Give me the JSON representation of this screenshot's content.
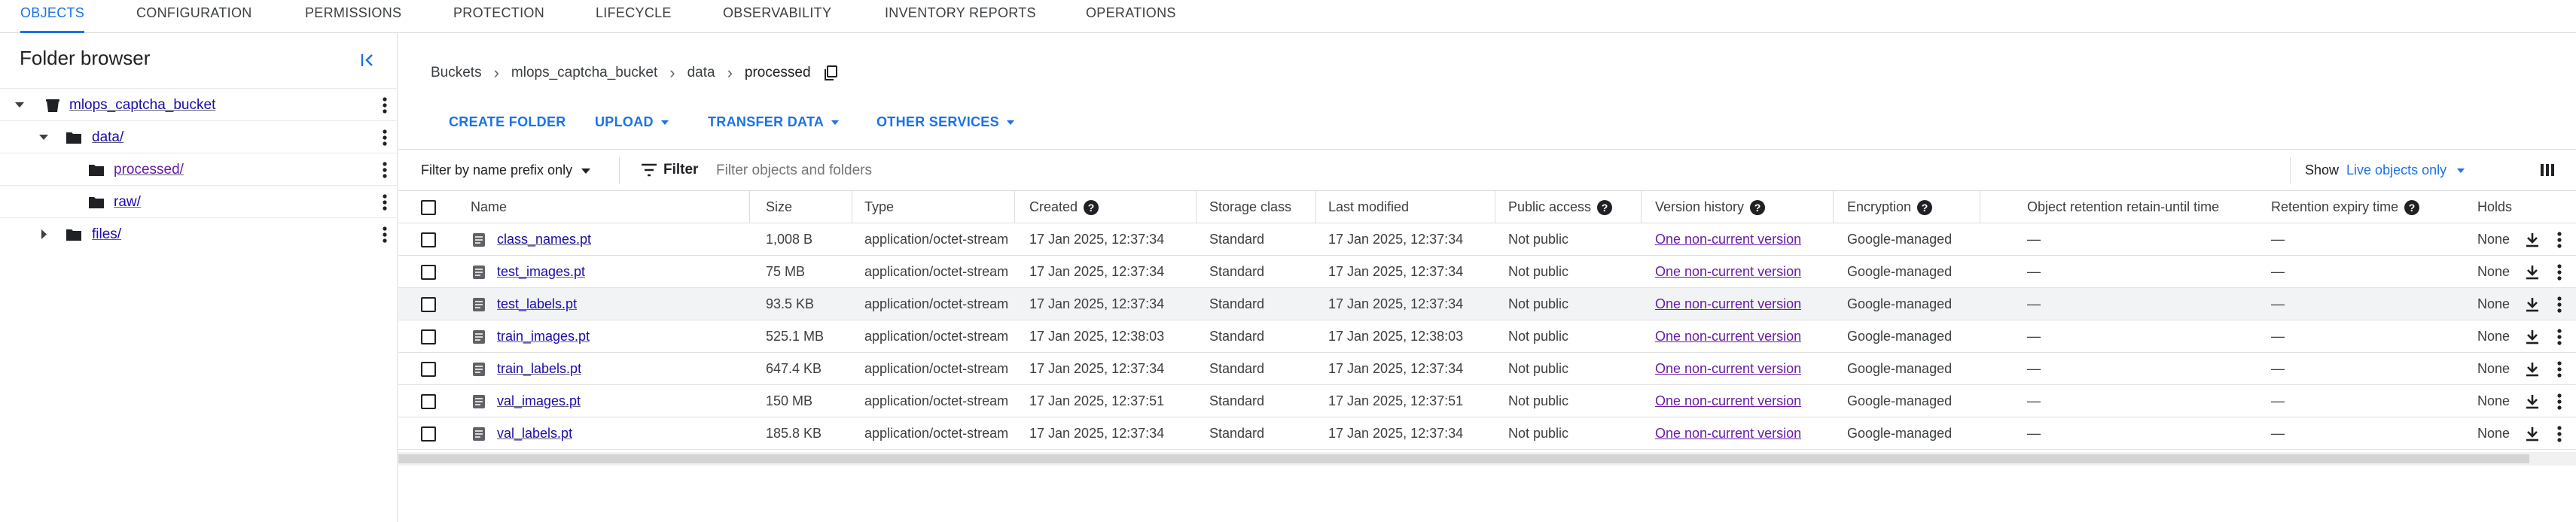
{
  "tabs": [
    {
      "label": "OBJECTS",
      "active": true
    },
    {
      "label": "CONFIGURATION"
    },
    {
      "label": "PERMISSIONS"
    },
    {
      "label": "PROTECTION"
    },
    {
      "label": "LIFECYCLE"
    },
    {
      "label": "OBSERVABILITY"
    },
    {
      "label": "INVENTORY REPORTS"
    },
    {
      "label": "OPERATIONS"
    }
  ],
  "sidebar": {
    "title": "Folder browser",
    "tree": [
      {
        "label": "mlops_captcha_bucket",
        "icon": "bucket-icon",
        "expanded": true
      },
      {
        "label": "data/",
        "icon": "folder-icon",
        "expanded": true
      },
      {
        "label": "processed/",
        "icon": "folder-icon"
      },
      {
        "label": "raw/",
        "icon": "folder-icon"
      },
      {
        "label": "files/",
        "icon": "folder-icon",
        "expanded": false
      }
    ]
  },
  "breadcrumb": {
    "items": [
      "Buckets",
      "mlops_captcha_bucket",
      "data",
      "processed"
    ]
  },
  "actions": {
    "create_folder": "CREATE FOLDER",
    "upload": "UPLOAD",
    "transfer_data": "TRANSFER DATA",
    "other_services": "OTHER SERVICES"
  },
  "filterbar": {
    "prefix_mode": "Filter by name prefix only",
    "filter_label": "Filter",
    "placeholder": "Filter objects and folders",
    "show_label": "Show",
    "show_value": "Live objects only"
  },
  "table": {
    "columns": [
      "Name",
      "Size",
      "Type",
      "Created",
      "Storage class",
      "Last modified",
      "Public access",
      "Version history",
      "Encryption",
      "Object retention retain-until time",
      "Retention expiry time",
      "Holds"
    ],
    "rows": [
      {
        "name": "class_names.pt",
        "size": "1,008 B",
        "type": "application/octet-stream",
        "created": "17 Jan 2025, 12:37:34",
        "storage": "Standard",
        "modified": "17 Jan 2025, 12:37:34",
        "public": "Not public",
        "version": "One non-current version",
        "encryption": "Google-managed",
        "retain": "—",
        "expiry": "—",
        "holds": "None"
      },
      {
        "name": "test_images.pt",
        "size": "75 MB",
        "type": "application/octet-stream",
        "created": "17 Jan 2025, 12:37:34",
        "storage": "Standard",
        "modified": "17 Jan 2025, 12:37:34",
        "public": "Not public",
        "version": "One non-current version",
        "encryption": "Google-managed",
        "retain": "—",
        "expiry": "—",
        "holds": "None"
      },
      {
        "name": "test_labels.pt",
        "size": "93.5 KB",
        "type": "application/octet-stream",
        "created": "17 Jan 2025, 12:37:34",
        "storage": "Standard",
        "modified": "17 Jan 2025, 12:37:34",
        "public": "Not public",
        "version": "One non-current version",
        "encryption": "Google-managed",
        "retain": "—",
        "expiry": "—",
        "holds": "None"
      },
      {
        "name": "train_images.pt",
        "size": "525.1 MB",
        "type": "application/octet-stream",
        "created": "17 Jan 2025, 12:38:03",
        "storage": "Standard",
        "modified": "17 Jan 2025, 12:38:03",
        "public": "Not public",
        "version": "One non-current version",
        "encryption": "Google-managed",
        "retain": "—",
        "expiry": "—",
        "holds": "None"
      },
      {
        "name": "train_labels.pt",
        "size": "647.4 KB",
        "type": "application/octet-stream",
        "created": "17 Jan 2025, 12:37:34",
        "storage": "Standard",
        "modified": "17 Jan 2025, 12:37:34",
        "public": "Not public",
        "version": "One non-current version",
        "encryption": "Google-managed",
        "retain": "—",
        "expiry": "—",
        "holds": "None"
      },
      {
        "name": "val_images.pt",
        "size": "150 MB",
        "type": "application/octet-stream",
        "created": "17 Jan 2025, 12:37:51",
        "storage": "Standard",
        "modified": "17 Jan 2025, 12:37:51",
        "public": "Not public",
        "version": "One non-current version",
        "encryption": "Google-managed",
        "retain": "—",
        "expiry": "—",
        "holds": "None"
      },
      {
        "name": "val_labels.pt",
        "size": "185.8 KB",
        "type": "application/octet-stream",
        "created": "17 Jan 2025, 12:37:34",
        "storage": "Standard",
        "modified": "17 Jan 2025, 12:37:34",
        "public": "Not public",
        "version": "One non-current version",
        "encryption": "Google-managed",
        "retain": "—",
        "expiry": "—",
        "holds": "None"
      }
    ]
  },
  "colors": {
    "accent": "#1a73e8",
    "link": "#1a0dab",
    "visited": "#681da8",
    "border": "#dadce0"
  }
}
